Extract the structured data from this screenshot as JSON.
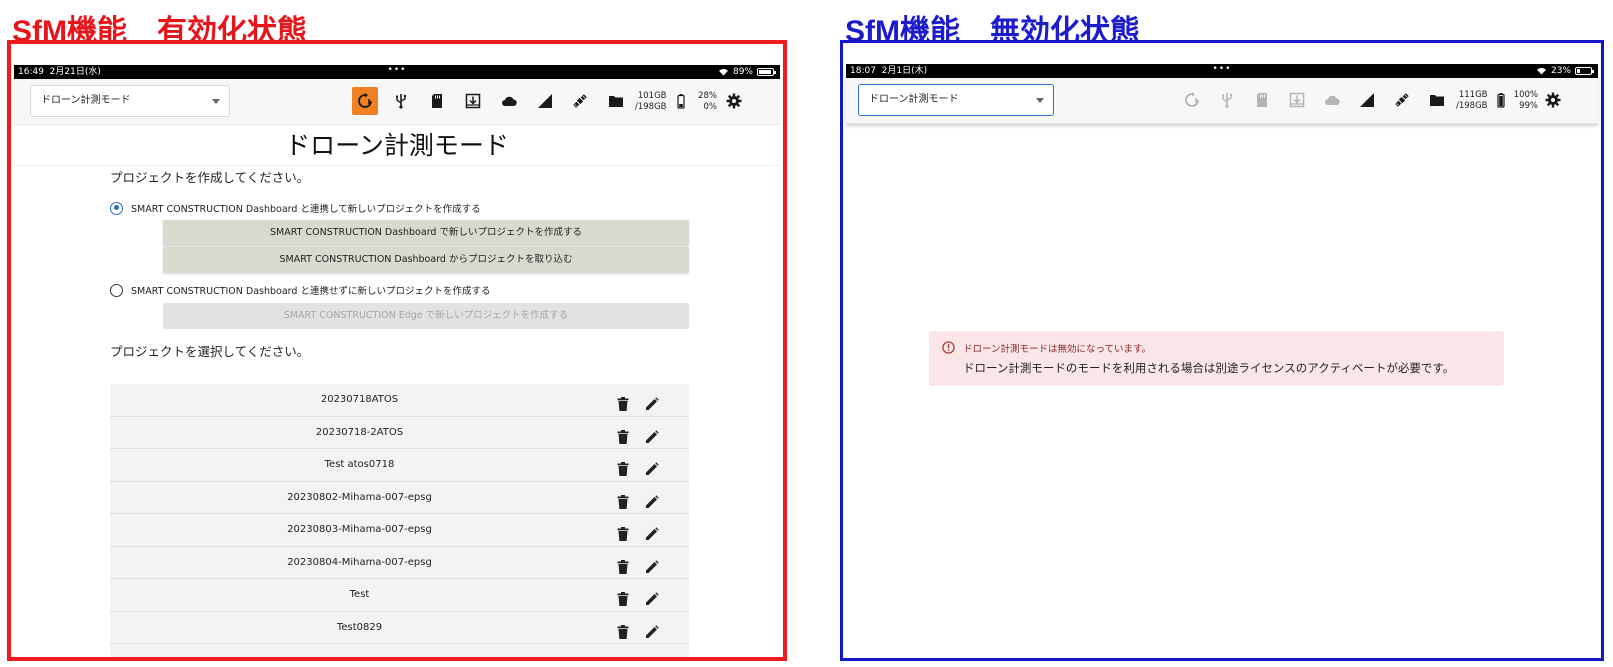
{
  "headings": {
    "enabled": "SfM機能　有効化状態",
    "disabled": "SfM機能　無効化状態"
  },
  "enabled_panel": {
    "status": {
      "time": "16:49",
      "date": "2月21日(水)",
      "dots": "•••",
      "battery": "89%",
      "battery_level": 0.89
    },
    "mode_select": {
      "value": "ドローン計測モード"
    },
    "storage": {
      "free": "101GB",
      "total": "/198GB"
    },
    "percent": {
      "top": "28%",
      "bottom": "0%"
    },
    "page_title": "ドローン計測モード",
    "create_prompt": "プロジェクトを作成してください。",
    "option_linked": "SMART CONSTRUCTION Dashboard と連携して新しいプロジェクトを作成する",
    "btn_create_dashboard": "SMART CONSTRUCTION Dashboard で新しいプロジェクトを作成する",
    "btn_import_dashboard": "SMART CONSTRUCTION Dashboard からプロジェクトを取り込む",
    "option_unlinked": "SMART CONSTRUCTION Dashboard と連携せずに新しいプロジェクトを作成する",
    "btn_create_edge": "SMART CONSTRUCTION Edge で新しいプロジェクトを作成する",
    "select_prompt": "プロジェクトを選択してください。",
    "projects": [
      "20230718ATOS",
      "20230718-2ATOS",
      "Test atos0718",
      "20230802-Mihama-007-epsg",
      "20230803-Mihama-007-epsg",
      "20230804-Mihama-007-epsg",
      "Test",
      "Test0829"
    ]
  },
  "disabled_panel": {
    "status": {
      "time": "18:07",
      "date": "2月1日(木)",
      "dots": "•••",
      "battery": "23%",
      "battery_level": 0.23
    },
    "mode_select": {
      "value": "ドローン計測モード"
    },
    "storage": {
      "free": "111GB",
      "total": "/198GB"
    },
    "percent": {
      "top": "100%",
      "bottom": "99%"
    },
    "alert": {
      "title": "ドローン計測モードは無効になっています。",
      "message": "ドローン計測モードのモードを利用される場合は別途ライセンスのアクティベートが必要です。"
    }
  },
  "colors": {
    "enabled_frame": "#ee1c1c",
    "disabled_frame": "#1515c8",
    "active_icon": "#f08023",
    "radio_selected": "#2a68c4",
    "alert_bg": "#fae6e6"
  },
  "icons": [
    "sync-alert-icon",
    "usb-icon",
    "sd-card-icon",
    "download-icon",
    "cloud-icon",
    "signal-icon",
    "satellite-icon",
    "folder-icon",
    "battery-icon",
    "gear-icon",
    "trash-icon",
    "pencil-icon",
    "error-circle-icon"
  ]
}
